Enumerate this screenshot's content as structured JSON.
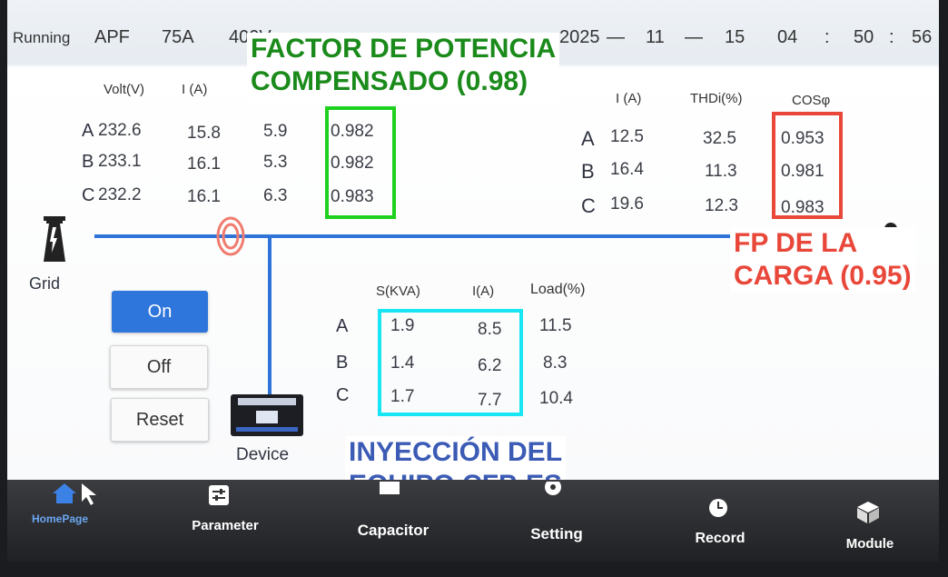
{
  "header": {
    "status": "Running",
    "model": "APF",
    "current": "75A",
    "voltage": "400V",
    "date_year": "2025",
    "date_month": "11",
    "date_day": "15",
    "dash": "—",
    "time_h": "04",
    "time_m": "50",
    "time_s": "56",
    "colon": ":"
  },
  "grid_table": {
    "headers": [
      "Volt(V)",
      "I (A)"
    ],
    "rows": [
      {
        "phase": "A",
        "volt": "232.6",
        "i": "15.8",
        "thd": "5.9",
        "pf": "0.982"
      },
      {
        "phase": "B",
        "volt": "233.1",
        "i": "16.1",
        "thd": "5.3",
        "pf": "0.982"
      },
      {
        "phase": "C",
        "volt": "232.2",
        "i": "16.1",
        "thd": "6.3",
        "pf": "0.983"
      }
    ]
  },
  "load_table": {
    "headers": [
      "I (A)",
      "THDi(%)",
      "COSφ"
    ],
    "rows": [
      {
        "phase": "A",
        "i": "12.5",
        "thd": "32.5",
        "cos": "0.953"
      },
      {
        "phase": "B",
        "i": "16.4",
        "thd": "11.3",
        "cos": "0.981"
      },
      {
        "phase": "C",
        "i": "19.6",
        "thd": "12.3",
        "cos": "0.983"
      }
    ]
  },
  "device_table": {
    "headers": [
      "S(KVA)",
      "I(A)",
      "Load(%)"
    ],
    "rows": [
      {
        "phase": "A",
        "s": "1.9",
        "i": "8.5",
        "load": "11.5"
      },
      {
        "phase": "B",
        "s": "1.4",
        "i": "6.2",
        "load": "8.3"
      },
      {
        "phase": "C",
        "s": "1.7",
        "i": "7.7",
        "load": "10.4"
      }
    ]
  },
  "labels": {
    "grid": "Grid",
    "device": "Device"
  },
  "buttons": {
    "on": "On",
    "off": "Off",
    "reset": "Reset"
  },
  "annotations": {
    "green_1": "FACTOR DE POTENCIA",
    "green_2": "COMPENSADO (0.98)",
    "red_1": "FP DE LA",
    "red_2": "CARGA (0.95)",
    "blue_1": "INYECCIÓN DEL",
    "blue_2": "EQUIPO CFP-ES"
  },
  "nav": [
    {
      "label": "HomePage",
      "icon": "home-icon"
    },
    {
      "label": "Parameter",
      "icon": "parameter-icon"
    },
    {
      "label": "Capacitor",
      "icon": "capacitor-icon"
    },
    {
      "label": "Setting",
      "icon": "gear-icon"
    },
    {
      "label": "Record",
      "icon": "clock-icon"
    },
    {
      "label": "Module",
      "icon": "cube-icon"
    }
  ],
  "colors": {
    "accent_blue": "#2e76db",
    "annotation_green": "#1a8a1a",
    "box_green": "#1fd11f",
    "annotation_red": "#e8473a",
    "box_cyan": "#19e6f5",
    "annotation_blue": "#3b5bb5"
  }
}
